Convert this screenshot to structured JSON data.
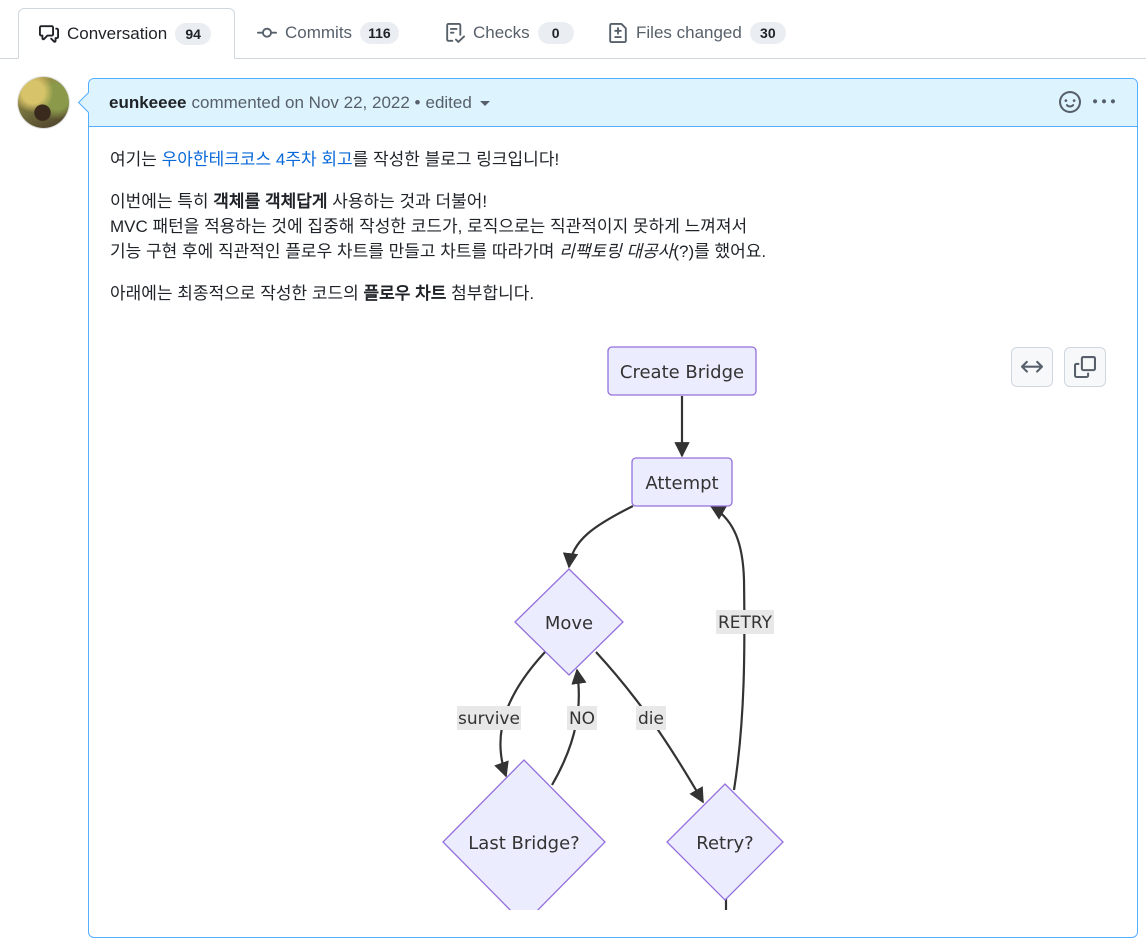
{
  "tabs": [
    {
      "label": "Conversation",
      "count": "94",
      "icon": "comment-discussion-icon"
    },
    {
      "label": "Commits",
      "count": "116",
      "icon": "git-commit-icon"
    },
    {
      "label": "Checks",
      "count": "0",
      "icon": "checklist-icon"
    },
    {
      "label": "Files changed",
      "count": "30",
      "icon": "file-diff-icon"
    }
  ],
  "comment": {
    "author": "eunkeeee",
    "meta": "commented on Nov 22, 2022 •",
    "edited": "edited",
    "body": {
      "p1_link": "우아한테크코스 4주차 회고",
      "p1_after": "를 작성한 블로그 링크입니다!",
      "p1_before": "여기는 ",
      "p2_line1_a": "이번에는 특히 ",
      "p2_line1_b": "객체를 객체답게",
      "p2_line1_c": " 사용하는 것과 더불어!",
      "p2_line2": "MVC 패턴을 적용하는 것에 집중해 작성한 코드가, 로직으로는 직관적이지 못하게 느껴져서",
      "p2_line3_a": "기능 구현 후에 직관적인 플로우 차트를 만들고 차트를 따라가며 ",
      "p2_line3_b": "리팩토링 대공사",
      "p2_line3_c": "(?)를 했어요.",
      "p3_a": "아래에는 최종적으로 작성한 코드의 ",
      "p3_b": "플로우 차트",
      "p3_c": " 첨부합니다."
    }
  },
  "diagram": {
    "nodes": {
      "create_bridge": "Create Bridge",
      "attempt": "Attempt",
      "move": "Move",
      "last_bridge": "Last Bridge?",
      "retry": "Retry?"
    },
    "edges": {
      "survive": "survive",
      "no": "NO",
      "die": "die",
      "retry": "RETRY"
    },
    "colors": {
      "node_fill": "#ECECFF",
      "node_stroke": "#9370DB",
      "edge": "#333333",
      "label_bg": "#E8E8E8"
    }
  }
}
